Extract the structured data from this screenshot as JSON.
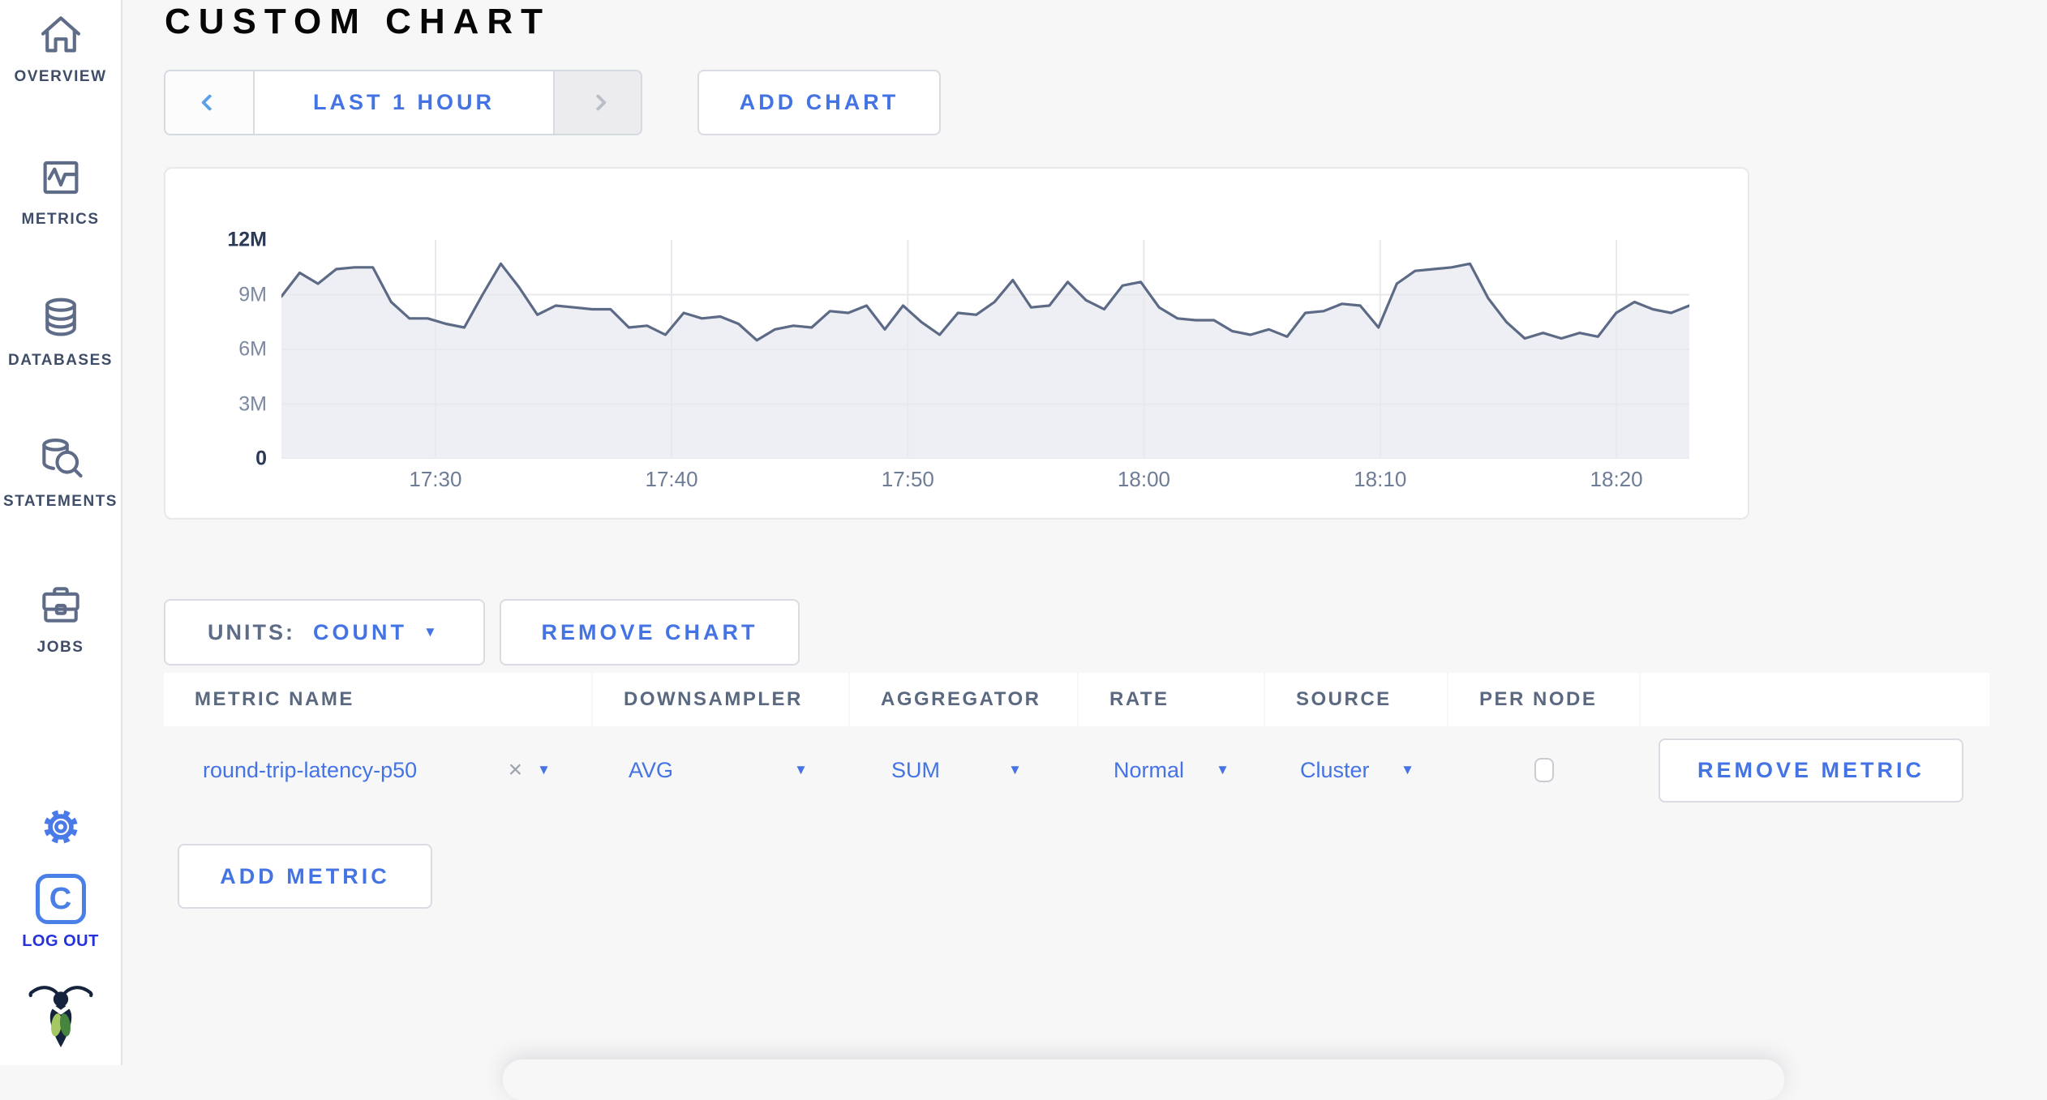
{
  "colors": {
    "accent_blue": "#4473e3",
    "logout_blue": "#2531dc",
    "sidebar_slate": "#3f4d68"
  },
  "sidebar": {
    "items": [
      {
        "label": "OVERVIEW"
      },
      {
        "label": "METRICS"
      },
      {
        "label": "DATABASES"
      },
      {
        "label": "STATEMENTS"
      },
      {
        "label": "JOBS"
      }
    ],
    "logo_letter": "C",
    "logout_label": "LOG OUT"
  },
  "header": {
    "title": "CUSTOM CHART"
  },
  "toolbar": {
    "time_range_label": "LAST 1 HOUR",
    "add_chart_label": "ADD CHART"
  },
  "chart_data": {
    "type": "area",
    "title": "",
    "xlabel": "",
    "ylabel": "",
    "x_tick_labels": [
      "17:30",
      "17:40",
      "17:50",
      "18:00",
      "18:10",
      "18:20"
    ],
    "x_tick_fractions": [
      0.1094,
      0.2771,
      0.4449,
      0.6126,
      0.7804,
      0.9482
    ],
    "y_ticks": [
      {
        "label": "12M",
        "millions": 12
      },
      {
        "label": "9M",
        "millions": 9
      },
      {
        "label": "6M",
        "millions": 6
      },
      {
        "label": "3M",
        "millions": 3
      },
      {
        "label": "0",
        "millions": 0
      }
    ],
    "y_grid_millions": [
      9,
      6,
      3,
      0
    ],
    "y_max_millions": 12,
    "ylim": [
      0,
      12000000
    ],
    "grid_on": true,
    "legend": "none",
    "series": [
      {
        "name": "round-trip-latency-p50",
        "values_millions": [
          8.9,
          10.2,
          9.6,
          10.4,
          10.5,
          10.5,
          8.6,
          7.7,
          7.7,
          7.4,
          7.2,
          9.0,
          10.7,
          9.4,
          7.9,
          8.4,
          8.3,
          8.2,
          8.2,
          7.2,
          7.3,
          6.8,
          8.0,
          7.7,
          7.8,
          7.4,
          6.5,
          7.1,
          7.3,
          7.2,
          8.1,
          8.0,
          8.4,
          7.1,
          8.4,
          7.5,
          6.8,
          8.0,
          7.9,
          8.6,
          9.8,
          8.3,
          8.4,
          9.7,
          8.7,
          8.2,
          9.5,
          9.7,
          8.3,
          7.7,
          7.6,
          7.6,
          7.0,
          6.8,
          7.1,
          6.7,
          8.0,
          8.1,
          8.5,
          8.4,
          7.2,
          9.6,
          10.3,
          10.4,
          10.5,
          10.7,
          8.8,
          7.5,
          6.6,
          6.9,
          6.6,
          6.9,
          6.7,
          8.0,
          8.6,
          8.2,
          8.0,
          8.4
        ]
      }
    ],
    "line_color": "#5c6a86",
    "fill_color": "#edeff4",
    "grid_color": "#e8e9ec"
  },
  "chart_controls": {
    "units_label": "UNITS:",
    "units_value": "COUNT",
    "remove_chart_label": "REMOVE CHART"
  },
  "metrics_table": {
    "columns": [
      "METRIC NAME",
      "DOWNSAMPLER",
      "AGGREGATOR",
      "RATE",
      "SOURCE",
      "PER NODE"
    ],
    "rows": [
      {
        "metric_name": "round-trip-latency-p50",
        "downsampler": "AVG",
        "aggregator": "SUM",
        "rate": "Normal",
        "source": "Cluster",
        "per_node_checked": false,
        "remove_label": "REMOVE METRIC"
      }
    ],
    "add_metric_label": "ADD METRIC"
  }
}
